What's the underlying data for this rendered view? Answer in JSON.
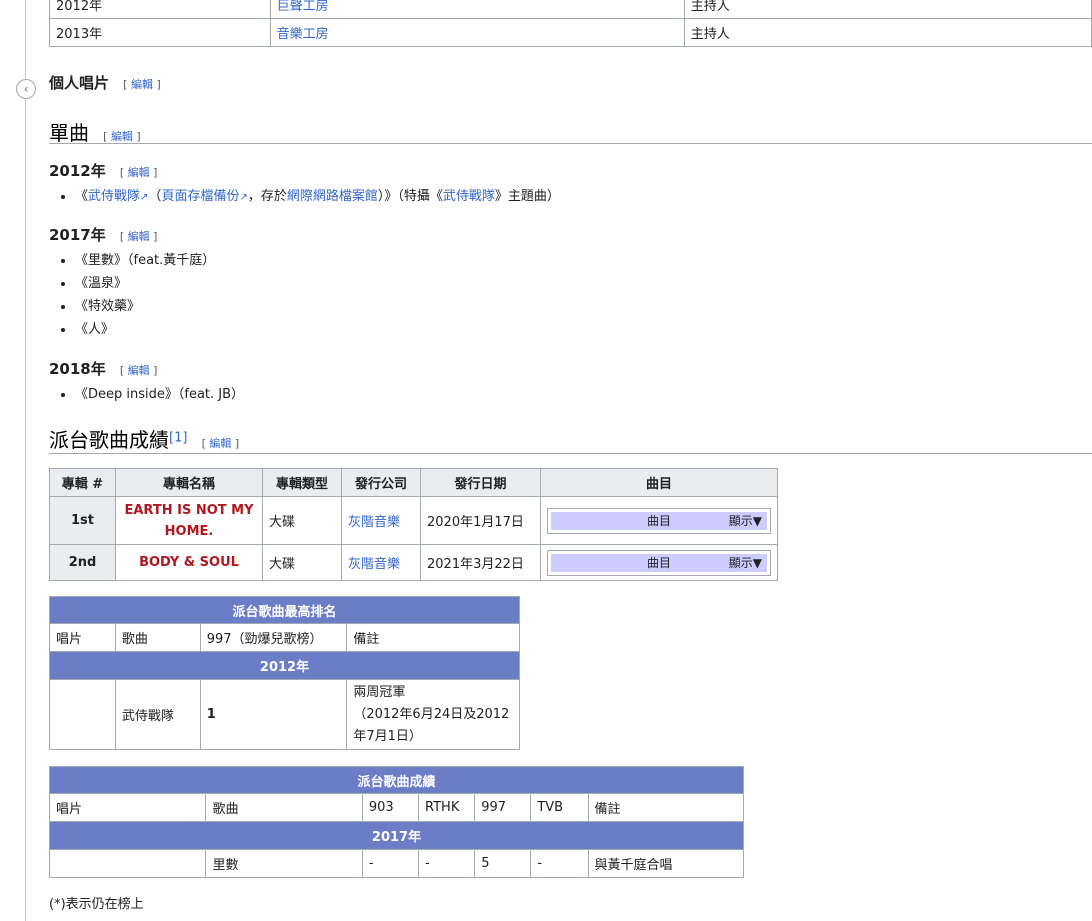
{
  "top_table": {
    "rows": [
      {
        "year": "2012年",
        "show": "巨聲工房",
        "role": "主持人"
      },
      {
        "year": "2013年",
        "show": "音樂工房",
        "role": "主持人"
      }
    ]
  },
  "edit_label": "編輯",
  "sections": {
    "personal_records": "個人唱片",
    "singles": "單曲",
    "y2012": "2012年",
    "y2017": "2017年",
    "y2018": "2018年",
    "chart_results": "派台歌曲成績",
    "chart_ref": "[1]"
  },
  "singles_2012": {
    "open": "《",
    "link1": "武侍戰隊",
    "paren_open": "（",
    "link2": "頁面存檔備份",
    "mid": "，存於",
    "link3": "網際網路檔案館",
    "paren_close": "）》（特攝《",
    "link4": "武侍戰隊",
    "tail": "》主題曲）"
  },
  "singles_2017": [
    "《里數》（feat.黃千庭）",
    "《溫泉》",
    "《特效藥》",
    "《人》"
  ],
  "singles_2018": [
    "《Deep inside》（feat. JB）"
  ],
  "album_table": {
    "headers": [
      "專輯 #",
      "專輯名稱",
      "專輯類型",
      "發行公司",
      "發行日期",
      "曲目"
    ],
    "rows": [
      {
        "num": "1st",
        "name_line1": "EARTH IS NOT MY",
        "name_line2": "HOME.",
        "type": "大碟",
        "company": "灰階音樂",
        "date": "2020年1月17日",
        "tracks": "曲目",
        "show": "顯示▼"
      },
      {
        "num": "2nd",
        "name_line1": "BODY & SOUL",
        "name_line2": "",
        "type": "大碟",
        "company": "灰階音樂",
        "date": "2021年3月22日",
        "tracks": "曲目",
        "show": "顯示▼"
      }
    ]
  },
  "peak_table": {
    "title": "派台歌曲最高排名",
    "headers": [
      "唱片",
      "歌曲",
      "997（勁爆兒歌榜）",
      "備註"
    ],
    "year": "2012年",
    "row": {
      "album": "",
      "song": "武侍戰隊",
      "rank": "1",
      "note_l1": "兩周冠軍",
      "note_l2": "（2012年6月24日及2012",
      "note_l3": "年7月1日）"
    }
  },
  "results_table": {
    "title": "派台歌曲成績",
    "headers": [
      "唱片",
      "歌曲",
      "903",
      "RTHK",
      "997",
      "TVB",
      "備註"
    ],
    "year": "2017年",
    "row": {
      "album": "",
      "song": "里數",
      "c903": "-",
      "rthk": "-",
      "c997": "5",
      "tvb": "-",
      "note": "與黃千庭合唱"
    }
  },
  "footnote": "(*)表示仍在榜上",
  "colors": {
    "link": "#3366cc",
    "album_name": "#b0171f",
    "chart_header": "#6c7dc8",
    "tracks_bg": "#ccccff"
  },
  "icons": {
    "collapse": "chevron-left-icon",
    "external": "external-link-icon"
  }
}
